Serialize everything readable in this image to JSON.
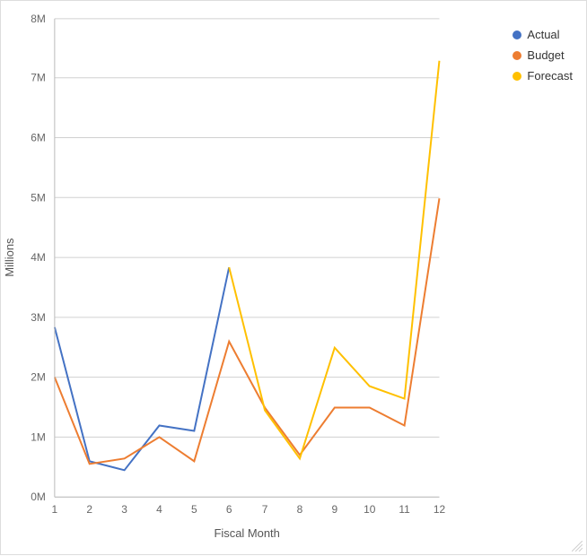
{
  "chart": {
    "title": "",
    "xAxisLabel": "Fiscal Month",
    "yAxisLabel": "Millions",
    "xLabels": [
      "1",
      "2",
      "3",
      "4",
      "5",
      "6",
      "7",
      "8",
      "9",
      "10",
      "11",
      "12"
    ],
    "yLabels": [
      "0M",
      "1M",
      "2M",
      "3M",
      "4M",
      "5M",
      "6M",
      "7M",
      "8M"
    ],
    "legend": [
      {
        "label": "Actual",
        "color": "#4472C4"
      },
      {
        "label": "Budget",
        "color": "#ED7D31"
      },
      {
        "label": "Forecast",
        "color": "#FFC000"
      }
    ],
    "series": {
      "actual": [
        2.85,
        0.6,
        0.45,
        1.2,
        1.1,
        3.85,
        null,
        null,
        null,
        null,
        null,
        null
      ],
      "budget": [
        2.0,
        0.55,
        0.65,
        1.0,
        0.6,
        2.6,
        1.5,
        0.7,
        1.5,
        1.5,
        1.2,
        5.0
      ],
      "forecast": [
        null,
        null,
        null,
        null,
        null,
        3.85,
        1.45,
        0.65,
        2.5,
        1.85,
        1.65,
        7.3
      ]
    }
  }
}
